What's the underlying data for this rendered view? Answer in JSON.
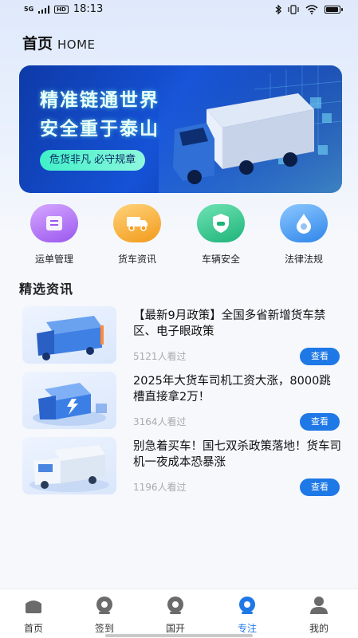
{
  "status_bar": {
    "signal": "5G",
    "hd": "HD",
    "time": "18:13"
  },
  "header": {
    "title": "首页",
    "subtitle": "HOME"
  },
  "banner": {
    "line1": "精准链通世界",
    "line2": "安全重于泰山",
    "pill": "危货非凡 必守规章"
  },
  "quick_menu": [
    {
      "label": "运单管理",
      "icon": "waybill-icon",
      "color": "#b47af2"
    },
    {
      "label": "货车资讯",
      "icon": "truck-icon",
      "color": "#f7b33a"
    },
    {
      "label": "车辆安全",
      "icon": "shield-car-icon",
      "color": "#33c28a"
    },
    {
      "label": "法律法规",
      "icon": "drop-icon",
      "color": "#3b92ee"
    }
  ],
  "section": {
    "title": "精选资讯"
  },
  "news": [
    {
      "title": "【最新9月政策】全国多省新增货车禁区、电子眼政策",
      "views": "5121人看过",
      "button": "查看"
    },
    {
      "title": "2025年大货车司机工资大涨，8000跳槽直接拿2万！",
      "views": "3164人看过",
      "button": "查看"
    },
    {
      "title": "别急着买车！国七双杀政策落地！货车司机一夜成本恐暴涨",
      "views": "1196人看过",
      "button": "查看"
    }
  ],
  "tabs": [
    {
      "label": "首页",
      "icon": "home-icon",
      "active": false
    },
    {
      "label": "签到",
      "icon": "checkin-icon",
      "active": false
    },
    {
      "label": "国开",
      "icon": "guokai-icon",
      "active": false
    },
    {
      "label": "专注",
      "icon": "focus-icon",
      "active": true
    },
    {
      "label": "我的",
      "icon": "profile-icon",
      "active": false
    }
  ],
  "colors": {
    "accent": "#1e78e6",
    "banner_bg": "#1552d6",
    "pill": "#3ff0c8"
  }
}
